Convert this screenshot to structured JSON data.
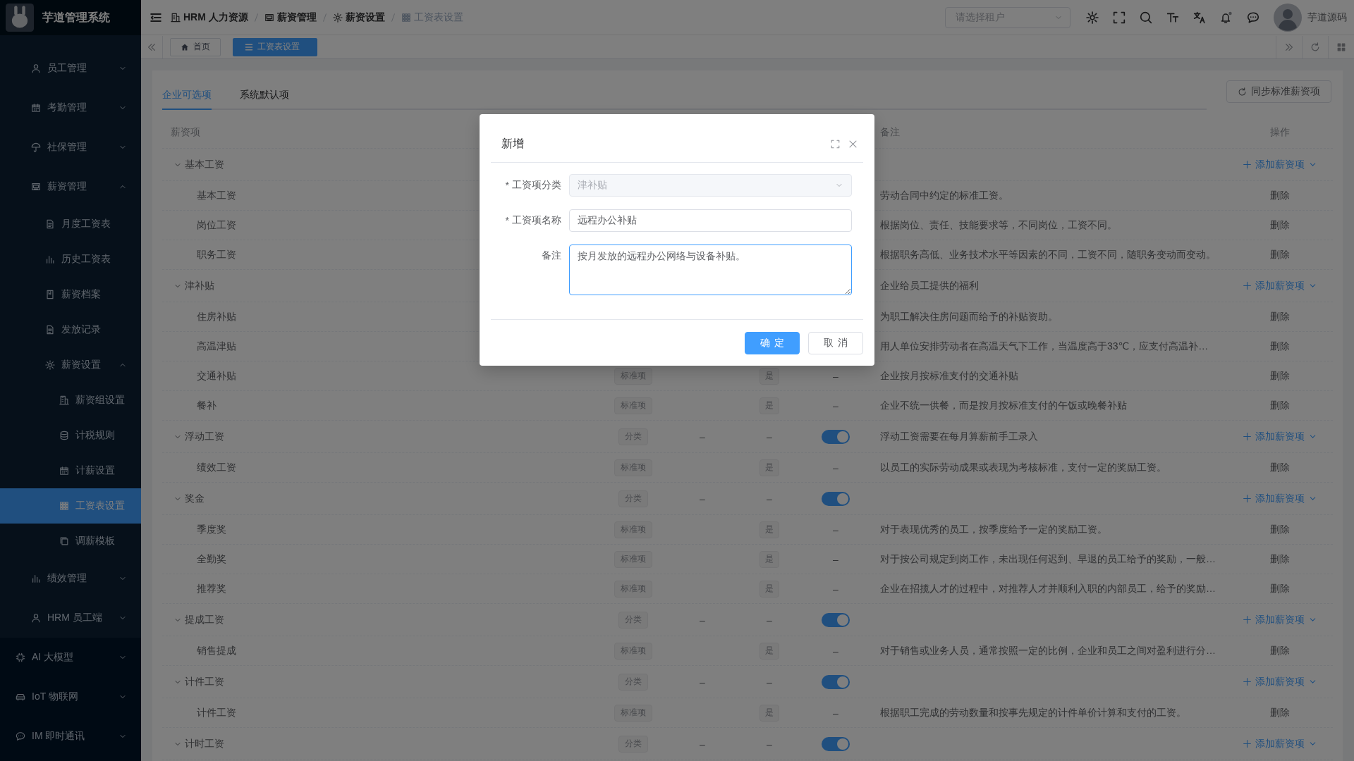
{
  "app": {
    "title": "芋道管理系统"
  },
  "sidebar": {
    "items": [
      {
        "label": "员工管理",
        "expanded": false,
        "selected": false
      },
      {
        "label": "考勤管理",
        "expanded": false,
        "selected": false
      },
      {
        "label": "社保管理",
        "expanded": false,
        "selected": false
      },
      {
        "label": "薪资管理",
        "expanded": true,
        "selected": false,
        "children": [
          {
            "label": "月度工资表",
            "selected": false
          },
          {
            "label": "历史工资表",
            "selected": false
          },
          {
            "label": "薪资档案",
            "selected": false
          },
          {
            "label": "发放记录",
            "selected": false
          },
          {
            "label": "薪资设置",
            "expanded": true,
            "selected": false,
            "children": [
              {
                "label": "薪资组设置",
                "selected": false
              },
              {
                "label": "计税规则",
                "selected": false
              },
              {
                "label": "计薪设置",
                "selected": false
              },
              {
                "label": "工资表设置",
                "selected": true
              },
              {
                "label": "调薪模板",
                "selected": false
              }
            ]
          }
        ]
      },
      {
        "label": "绩效管理",
        "expanded": false,
        "selected": false
      },
      {
        "label": "HRM 员工端",
        "expanded": false,
        "selected": false
      }
    ],
    "modules": [
      {
        "label": "AI 大模型",
        "expanded": false,
        "selected": false
      },
      {
        "label": "IoT 物联网",
        "expanded": false,
        "selected": false
      },
      {
        "label": "IM 即时通讯",
        "expanded": false,
        "selected": false
      }
    ]
  },
  "breadcrumb": [
    {
      "label": "HRM 人力资源",
      "current": false
    },
    {
      "label": "薪资管理",
      "current": false
    },
    {
      "label": "薪资设置",
      "current": false
    },
    {
      "label": "工资表设置",
      "current": true
    }
  ],
  "header": {
    "tenant_select": {
      "placeholder": "请选择租户"
    },
    "notification_dot": true,
    "user_name": "芋道源码"
  },
  "tags": [
    {
      "label": "首页",
      "selected": false
    },
    {
      "label": "工资表设置",
      "selected": true
    }
  ],
  "tabs": [
    {
      "label": "企业可选项",
      "selected": true
    },
    {
      "label": "系统默认项",
      "selected": false
    }
  ],
  "sync_button": "同步标准薪资项",
  "table": {
    "columns": [
      {
        "label": "薪资项"
      },
      {
        "label": "备注"
      },
      {
        "label": "操作"
      }
    ],
    "rows": [
      {
        "name": "基本工资",
        "expanded": true,
        "action": "添加薪资项",
        "children": [
          {
            "name": "基本工资",
            "remark": "劳动合同中约定的标准工资。",
            "action": "删除"
          },
          {
            "name": "岗位工资",
            "remark": "根据岗位、责任、技能要求等，不同岗位，工资不同。",
            "action": "删除"
          },
          {
            "name": "职务工资",
            "remark": "根据职务高低、业务技术水平等因素的不同，工资不同，随职务变动而变动。",
            "action": "删除"
          }
        ]
      },
      {
        "name": "津补贴",
        "expanded": true,
        "remark": "企业给员工提供的福利",
        "action": "添加薪资项",
        "children": [
          {
            "name": "住房补贴",
            "remark": "为职工解决住房问题而给予的补贴资助。",
            "action": "删除"
          },
          {
            "name": "高温津贴",
            "remark": "用人单位安排劳动者在高温天气下工作，当温度高于33℃，应支付高温补…",
            "action": "删除"
          },
          {
            "name": "交通补贴",
            "type_tag": "标准项",
            "column_4": "是",
            "column_5": "–",
            "remark": "企业按月按标准支付的交通补贴",
            "action": "删除"
          },
          {
            "name": "餐补",
            "type_tag": "标准项",
            "column_4": "是",
            "column_5": "–",
            "remark": "企业不统一供餐，而是按月按标准支付的午饭或晚餐补贴",
            "action": "删除"
          }
        ]
      },
      {
        "name": "浮动工资",
        "expanded": true,
        "type_tag": "分类",
        "column_3": "–",
        "column_4": "–",
        "on": true,
        "remark": "浮动工资需要在每月算薪前手工录入",
        "action": "添加薪资项",
        "children": [
          {
            "name": "绩效工资",
            "type_tag": "标准项",
            "column_4": "是",
            "column_5": "–",
            "remark": "以员工的实际劳动成果或表现为考核标准，支付一定的奖励工资。",
            "action": "删除"
          }
        ]
      },
      {
        "name": "奖金",
        "expanded": true,
        "type_tag": "分类",
        "column_3": "–",
        "column_4": "–",
        "on": true,
        "action": "添加薪资项",
        "children": [
          {
            "name": "季度奖",
            "type_tag": "标准项",
            "column_4": "是",
            "column_5": "–",
            "remark": "对于表现优秀的员工，按季度给予一定的奖励工资。",
            "action": "删除"
          },
          {
            "name": "全勤奖",
            "type_tag": "标准项",
            "column_4": "是",
            "column_5": "–",
            "remark": "对于按公司规定到岗工作，未出现任何迟到、早退的员工给予的奖励，一般…",
            "action": "删除"
          },
          {
            "name": "推荐奖",
            "type_tag": "标准项",
            "column_4": "是",
            "column_5": "–",
            "remark": "企业在招揽人才的过程中，对推荐人才并顺利入职的内部员工，给予的奖励…",
            "action": "删除"
          }
        ]
      },
      {
        "name": "提成工资",
        "expanded": true,
        "type_tag": "分类",
        "column_3": "–",
        "column_4": "–",
        "on": true,
        "action": "添加薪资项",
        "children": [
          {
            "name": "销售提成",
            "type_tag": "标准项",
            "column_4": "是",
            "column_5": "–",
            "remark": "对于销售或业务人员，通常按照一定的比例，企业和员工之间对盈利进行分…",
            "action": "删除"
          }
        ]
      },
      {
        "name": "计件工资",
        "expanded": true,
        "type_tag": "分类",
        "column_3": "–",
        "column_4": "–",
        "on": true,
        "action": "添加薪资项",
        "children": [
          {
            "name": "计件工资",
            "type_tag": "标准项",
            "column_4": "是",
            "column_5": "–",
            "remark": "根据职工完成的劳动数量和按事先规定的计件单价计算和支付的工资。",
            "action": "删除"
          }
        ]
      },
      {
        "name": "计时工资",
        "expanded": true,
        "type_tag": "分类",
        "column_3": "–",
        "column_4": "–",
        "on": true,
        "action": "添加薪资项"
      }
    ]
  },
  "dialog": {
    "title": "新增",
    "fields": [
      {
        "kind": "select",
        "required_mark": "*",
        "label": "工资项分类",
        "value": "津补贴",
        "disabled": true,
        "focused": false
      },
      {
        "kind": "input",
        "required_mark": "*",
        "label": "工资项名称",
        "value": "远程办公补贴",
        "disabled": false,
        "focused": false
      },
      {
        "kind": "textarea",
        "label": "备注",
        "value": "按月发放的远程办公网络与设备补贴。",
        "disabled": false,
        "focused": true
      }
    ],
    "buttons": [
      {
        "kind": "primary",
        "label": "确定"
      },
      {
        "kind": "default",
        "label": "取消"
      }
    ]
  }
}
